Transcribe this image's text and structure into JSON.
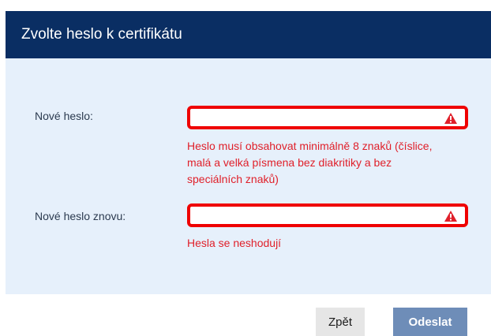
{
  "dialog": {
    "title": "Zvolte heslo k certifikátu"
  },
  "form": {
    "new_password": {
      "label": "Nové heslo:",
      "value": "",
      "error_line1": "Heslo musí obsahovat minimálně 8 znaků (číslice,",
      "error_line2": "malá a velká písmena bez diakritiky a bez",
      "error_line3": "speciálních znaků)",
      "icon": "warning-icon"
    },
    "confirm_password": {
      "label": "Nové heslo znovu:",
      "value": "",
      "error": "Hesla se neshodují",
      "icon": "warning-icon"
    }
  },
  "buttons": {
    "back_label": "Zpět",
    "submit_label": "Odeslat"
  },
  "colors": {
    "header": "#0a2e63",
    "body_background": "#e6f0fb",
    "error": "#e0202a",
    "field_border_error": "#ef0000",
    "submit_button": "#6e8db8"
  }
}
